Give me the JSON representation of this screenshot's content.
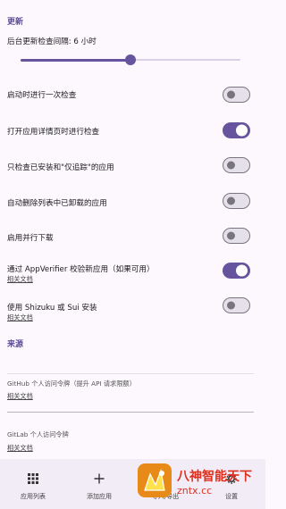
{
  "sections": {
    "updates": "更新",
    "sources": "来源"
  },
  "slider": {
    "label": "后台更新检查间隔: 6 小时",
    "value_hours": 6,
    "fraction": 0.5
  },
  "settings": [
    {
      "label": "启动时进行一次检查",
      "on": false
    },
    {
      "label": "打开应用详情页时进行检查",
      "on": true
    },
    {
      "label": "只检查已安装和\"仅追踪\"的应用",
      "on": false
    },
    {
      "label": "自动删除列表中已卸载的应用",
      "on": false
    },
    {
      "label": "启用并行下载",
      "on": false
    },
    {
      "label": "通过 AppVerifier 校验新应用（如果可用）",
      "sublabel": "相关文档",
      "on": true
    },
    {
      "label": "使用 Shizuku 或 Sui 安装",
      "sublabel": "相关文档",
      "on": false
    }
  ],
  "fields": [
    {
      "label": "GitHub 个人访问令牌（提升 API 请求限额）",
      "link": "相关文档"
    },
    {
      "label": "GitLab 个人访问令牌",
      "link": "相关文档"
    }
  ],
  "nav": [
    {
      "icon": "grid-icon",
      "label": "应用列表"
    },
    {
      "icon": "plus-icon",
      "label": "添加应用"
    },
    {
      "icon": "download-icon",
      "label": "导入/导出"
    },
    {
      "icon": "gear-icon",
      "label": "设置"
    }
  ],
  "watermark": {
    "title": "八神智能天下",
    "url": "zntx.cc"
  },
  "colors": {
    "accent": "#66549e",
    "background": "#fcf8fd",
    "toggle_off": "#7a7480"
  }
}
